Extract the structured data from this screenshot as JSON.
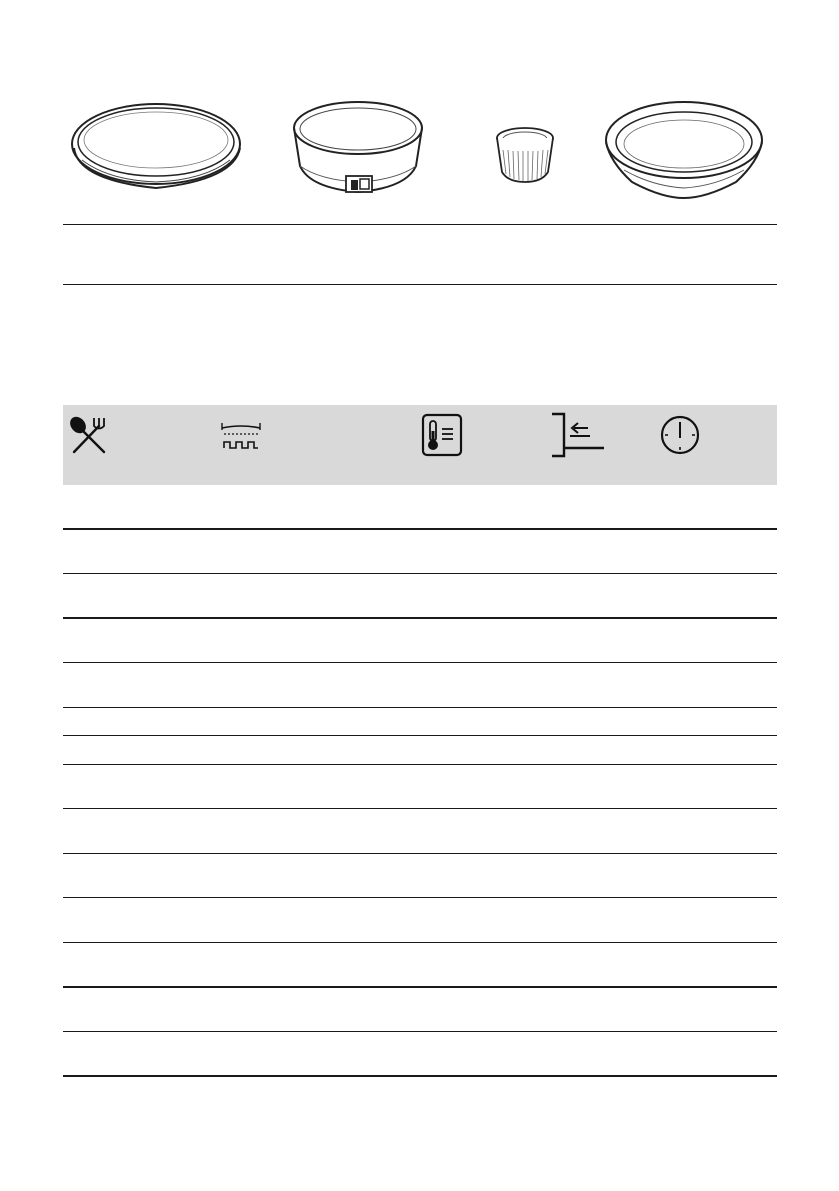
{
  "illustrations": [
    {
      "name": "flat-baking-tray",
      "label": ""
    },
    {
      "name": "springform-cake-tin",
      "label": ""
    },
    {
      "name": "ramekin",
      "label": ""
    },
    {
      "name": "deep-round-dish",
      "label": ""
    }
  ],
  "caption_row": {
    "text": ""
  },
  "table": {
    "header_icons": [
      {
        "icon": "cutlery-icon",
        "label": ""
      },
      {
        "icon": "heating-function-icon",
        "label": ""
      },
      {
        "icon": "thermometer-icon",
        "label": ""
      },
      {
        "icon": "shelf-position-icon",
        "label": ""
      },
      {
        "icon": "timer-icon",
        "label": ""
      }
    ],
    "rows": [
      {
        "dish": "",
        "function": "",
        "temperature": "",
        "shelf": "",
        "time": ""
      },
      {
        "dish": "",
        "function": "",
        "temperature": "",
        "shelf": "",
        "time": ""
      },
      {
        "dish": "",
        "function": "",
        "temperature": "",
        "shelf": "",
        "time": ""
      },
      {
        "dish": "",
        "function": "",
        "temperature": "",
        "shelf": "",
        "time": ""
      },
      {
        "dish": "",
        "function": "",
        "temperature": "",
        "shelf": "",
        "time": ""
      },
      {
        "dish": "",
        "function": "",
        "temperature": "",
        "shelf": "",
        "time": ""
      },
      {
        "dish": "",
        "function": "",
        "temperature": "",
        "shelf": "",
        "time": ""
      },
      {
        "dish": "",
        "function": "",
        "temperature": "",
        "shelf": "",
        "time": ""
      },
      {
        "dish": "",
        "function": "",
        "temperature": "",
        "shelf": "",
        "time": ""
      },
      {
        "dish": "",
        "function": "",
        "temperature": "",
        "shelf": "",
        "time": ""
      },
      {
        "dish": "",
        "function": "",
        "temperature": "",
        "shelf": "",
        "time": ""
      },
      {
        "dish": "",
        "function": "",
        "temperature": "",
        "shelf": "",
        "time": ""
      },
      {
        "dish": "",
        "function": "",
        "temperature": "",
        "shelf": "",
        "time": ""
      }
    ]
  },
  "colors": {
    "header_band": "#d9d9d9",
    "line": "#1a1a1a"
  }
}
